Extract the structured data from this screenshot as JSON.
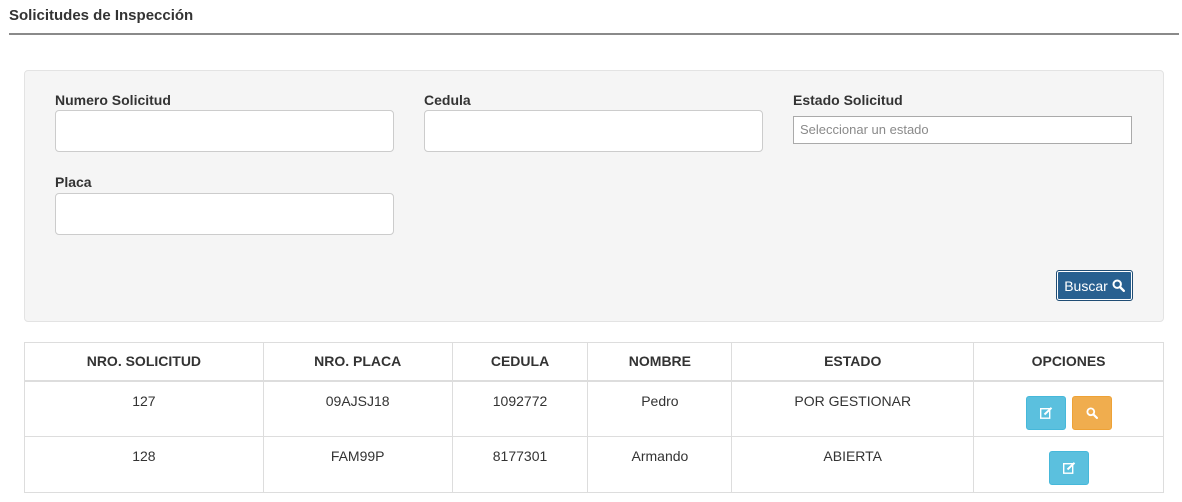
{
  "page": {
    "title": "Solicitudes de Inspección"
  },
  "filters": {
    "numero_solicitud": {
      "label": "Numero Solicitud",
      "value": ""
    },
    "cedula": {
      "label": "Cedula",
      "value": ""
    },
    "estado_solicitud": {
      "label": "Estado Solicitud",
      "placeholder": "Seleccionar un estado"
    },
    "placa": {
      "label": "Placa",
      "value": ""
    },
    "search_button": {
      "label": "Buscar",
      "icon": "search-icon",
      "color": "#286090"
    }
  },
  "table": {
    "headers": [
      "NRO. SOLICITUD",
      "NRO. PLACA",
      "CEDULA",
      "NOMBRE",
      "ESTADO",
      "OPCIONES"
    ],
    "rows": [
      {
        "nro_solicitud": "127",
        "nro_placa": "09AJSJ18",
        "cedula": "1092772",
        "nombre": "Pedro",
        "estado": "POR GESTIONAR",
        "actions": [
          "edit-icon",
          "search-icon"
        ]
      },
      {
        "nro_solicitud": "128",
        "nro_placa": "FAM99P",
        "cedula": "8177301",
        "nombre": "Armando",
        "estado": "ABIERTA",
        "actions": [
          "edit-icon"
        ]
      }
    ]
  },
  "colors": {
    "edit_button": "#5bc0de",
    "view_button": "#f0ad4e",
    "panel_bg": "#f5f5f5"
  }
}
